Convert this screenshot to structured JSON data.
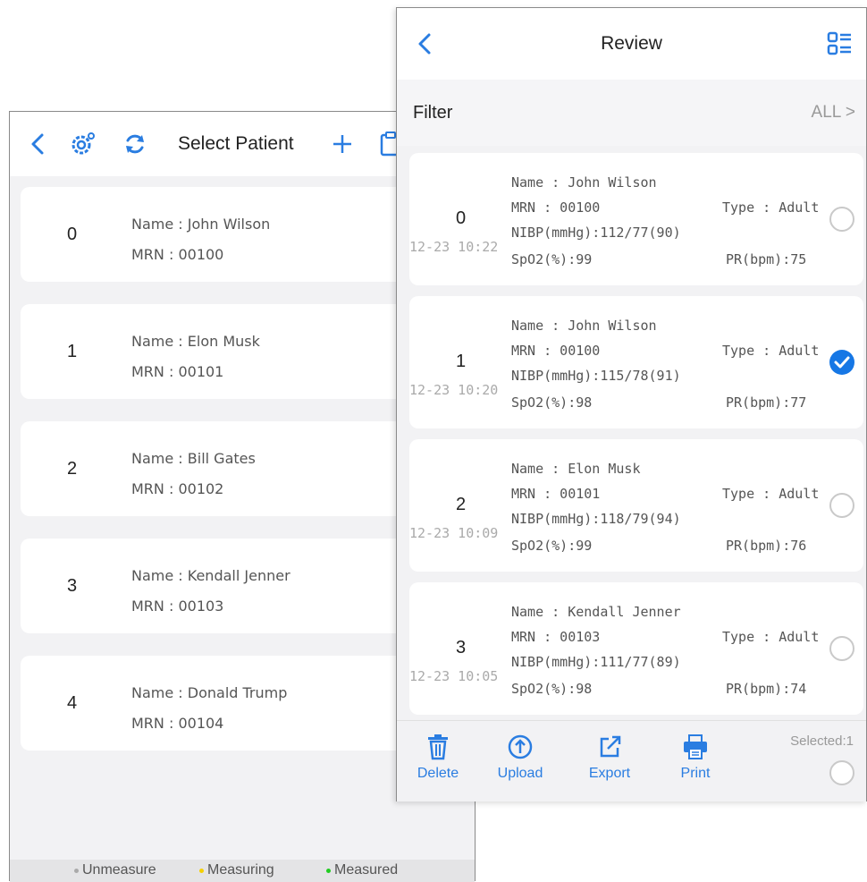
{
  "select_patient": {
    "title": "Select Patient",
    "patients": [
      {
        "index": "0",
        "name": "Name : John Wilson",
        "mrn": "MRN : 00100"
      },
      {
        "index": "1",
        "name": "Name : Elon Musk",
        "mrn": "MRN : 00101"
      },
      {
        "index": "2",
        "name": "Name : Bill Gates",
        "mrn": "MRN : 00102"
      },
      {
        "index": "3",
        "name": "Name : Kendall Jenner",
        "mrn": "MRN : 00103"
      },
      {
        "index": "4",
        "name": "Name : Donald Trump",
        "mrn": "MRN : 00104"
      }
    ],
    "legend": {
      "unmeasure": "Unmeasure",
      "measuring": "Measuring",
      "measured": "Measured"
    },
    "legend_colors": {
      "unmeasure": "#aaaaaa",
      "measuring": "#f5d000",
      "measured": "#22cc22"
    }
  },
  "review": {
    "title": "Review",
    "filter_label": "Filter",
    "filter_value": "ALL >",
    "records": [
      {
        "index": "0",
        "time": "12-23 10:22",
        "name": "Name : John Wilson",
        "mrn": "MRN : 00100",
        "type": "Type : Adult",
        "nibp": "NIBP(mmHg):112/77(90)",
        "spo2": "SpO2(%):99",
        "pr": "PR(bpm):75",
        "selected": false
      },
      {
        "index": "1",
        "time": "12-23 10:20",
        "name": "Name : John Wilson",
        "mrn": "MRN : 00100",
        "type": "Type : Adult",
        "nibp": "NIBP(mmHg):115/78(91)",
        "spo2": "SpO2(%):98",
        "pr": "PR(bpm):77",
        "selected": true
      },
      {
        "index": "2",
        "time": "12-23 10:09",
        "name": "Name : Elon Musk",
        "mrn": "MRN : 00101",
        "type": "Type : Adult",
        "nibp": "NIBP(mmHg):118/79(94)",
        "spo2": "SpO2(%):99",
        "pr": "PR(bpm):76",
        "selected": false
      },
      {
        "index": "3",
        "time": "12-23 10:05",
        "name": "Name : Kendall Jenner",
        "mrn": "MRN : 00103",
        "type": "Type : Adult",
        "nibp": "NIBP(mmHg):111/77(89)",
        "spo2": "SpO2(%):98",
        "pr": "PR(bpm):74",
        "selected": false
      }
    ],
    "toolbar": {
      "delete": "Delete",
      "upload": "Upload",
      "export": "Export",
      "print": "Print",
      "selected": "Selected:1"
    }
  },
  "colors": {
    "accent": "#2a7de1",
    "checked": "#1677e5"
  },
  "icons": [
    "back-icon",
    "settings-icon",
    "refresh-icon",
    "add-icon",
    "clipboard-icon",
    "list-view-icon",
    "trash-icon",
    "upload-icon",
    "export-icon",
    "print-icon",
    "check-icon"
  ]
}
